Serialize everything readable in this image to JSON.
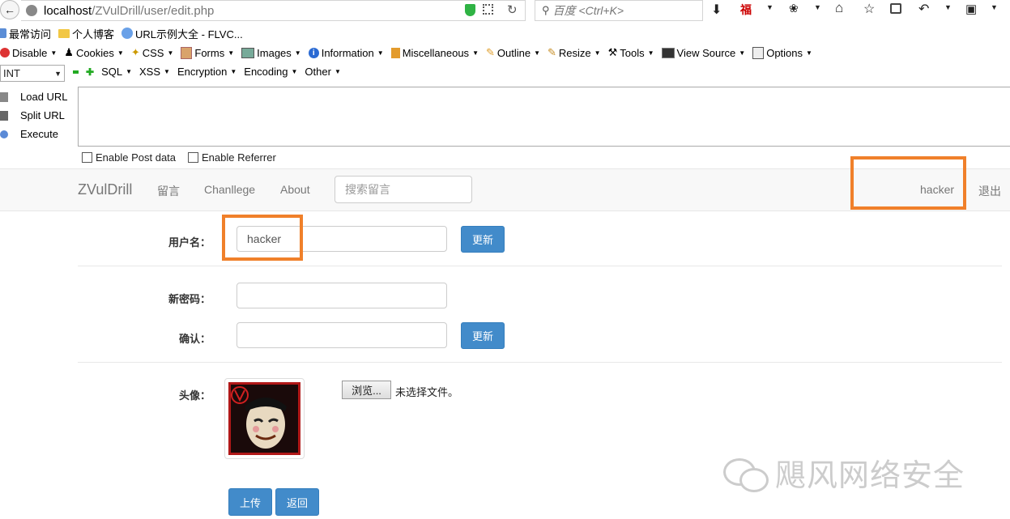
{
  "browser": {
    "url_host": "localhost",
    "url_path": "/ZVulDrill/user/edit.php",
    "search_placeholder": "百度 <Ctrl+K>"
  },
  "bookmarks": [
    "最常访问",
    "个人博客",
    "URL示例大全 - FLVC..."
  ],
  "webdev_toolbar": [
    "Disable",
    "Cookies",
    "CSS",
    "Forms",
    "Images",
    "Information",
    "Miscellaneous",
    "Outline",
    "Resize",
    "Tools",
    "View Source",
    "Options"
  ],
  "hackbar": {
    "select_value": "INT",
    "menus": [
      "SQL",
      "XSS",
      "Encryption",
      "Encoding",
      "Other"
    ],
    "actions": [
      "Load URL",
      "Split URL",
      "Execute"
    ],
    "enable_post": "Enable Post data",
    "enable_referrer": "Enable Referrer"
  },
  "site": {
    "brand": "ZVulDrill",
    "nav": [
      "留言",
      "Chanllege",
      "About"
    ],
    "search_placeholder": "搜索留言",
    "user": "hacker",
    "logout": "退出"
  },
  "form": {
    "username_label": "用户名：",
    "username_value": "hacker",
    "update_label": "更新",
    "newpass_label": "新密码：",
    "confirm_label": "确认：",
    "avatar_label": "头像：",
    "browse_label": "浏览...",
    "no_file": "未选择文件。",
    "upload_label": "上传",
    "back_label": "返回"
  },
  "watermark": "飓风网络安全",
  "colors": {
    "accent": "#428bca",
    "highlight": "#f0802a"
  }
}
